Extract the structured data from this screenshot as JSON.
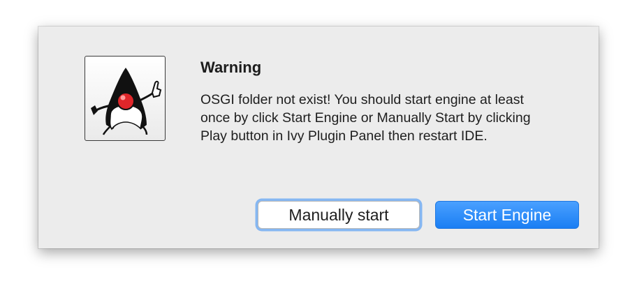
{
  "dialog": {
    "title": "Warning",
    "message": "OSGI folder not exist! You should start engine at least once by click Start Engine or Manually Start by clicking Play button in Ivy Plugin Panel then restart IDE.",
    "icon": "java-duke-icon",
    "buttons": {
      "manual_label": "Manually start",
      "start_label": "Start Engine"
    },
    "colors": {
      "primary_button": "#1a7ef3",
      "focus_ring": "#86b7f2",
      "dialog_bg": "#ececec"
    }
  }
}
